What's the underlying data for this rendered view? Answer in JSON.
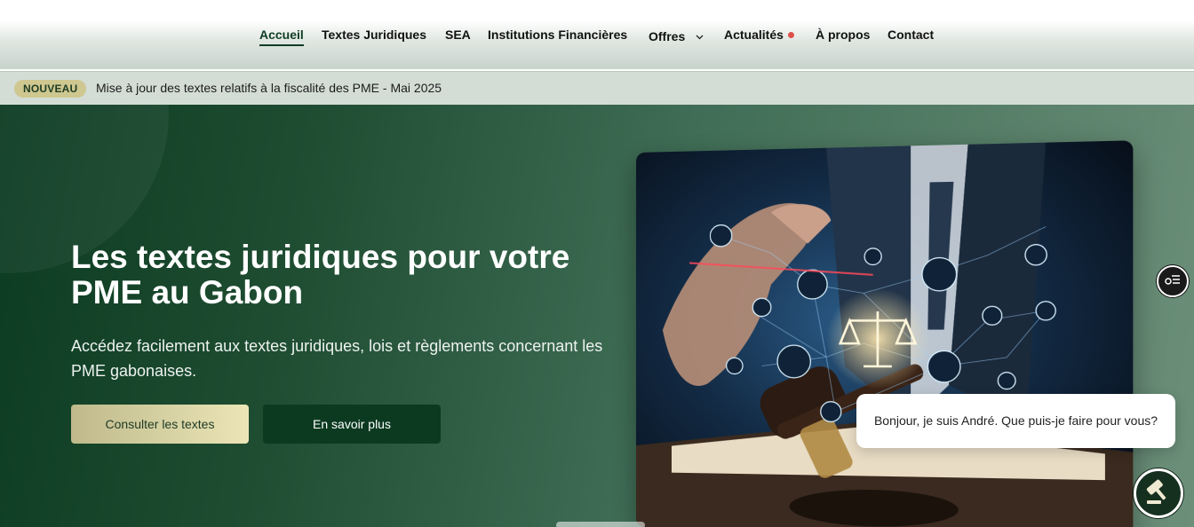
{
  "nav": {
    "items": [
      {
        "label": "Accueil",
        "active": true
      },
      {
        "label": "Textes Juridiques"
      },
      {
        "label": "SEA"
      },
      {
        "label": "Institutions Financières"
      },
      {
        "label": "Offres",
        "has_dropdown": true
      },
      {
        "label": "Actualités",
        "has_dot": true
      },
      {
        "label": "À propos"
      },
      {
        "label": "Contact"
      }
    ],
    "dropdown_icon": "chevron-down-icon",
    "dot_color": "#e0504b"
  },
  "ticker": {
    "badge": "NOUVEAU",
    "text": "Mise à jour des textes relatifs à la fiscalité des PME - Mai 2025"
  },
  "hero": {
    "title": "Les textes juridiques pour votre PME au Gabon",
    "description": "Accédez facilement aux textes juridiques, lois et règlements concernant les PME gabonaises.",
    "primary_button": "Consulter les textes",
    "secondary_button": "En savoir plus",
    "image_icon": "justice-gavel-digital-network-image"
  },
  "side_button": {
    "icon": "accessibility-menu-icon"
  },
  "chat": {
    "message": "Bonjour, je suis André. Que puis-je faire pour vous?",
    "avatar_icon": "gavel-icon"
  },
  "colors": {
    "brand_dark": "#0b3a20",
    "brand_gold": "#d7d2a4",
    "ticker_bg": "#d3ddd6"
  }
}
